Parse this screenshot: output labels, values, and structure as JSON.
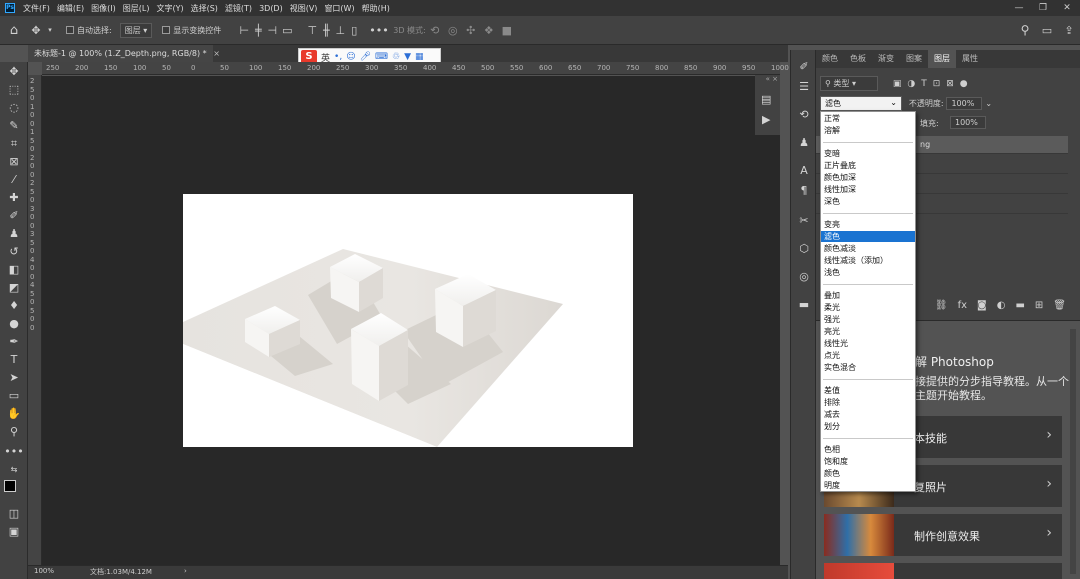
{
  "menubar": {
    "items": [
      "文件(F)",
      "编辑(E)",
      "图像(I)",
      "图层(L)",
      "文字(Y)",
      "选择(S)",
      "滤镜(T)",
      "3D(D)",
      "视图(V)",
      "窗口(W)",
      "帮助(H)"
    ]
  },
  "options": {
    "auto_select_label": "自动选择:",
    "layer_select": "图层",
    "show_transform_label": "显示变换控件",
    "mode_3d_label": "3D 模式:"
  },
  "document": {
    "tab_title": "未标题-1 @ 100% (1.Z_Depth.png, RGB/8) *",
    "close_glyph": "×"
  },
  "ruler": {
    "h_labels": [
      "250",
      "200",
      "150",
      "100",
      "50",
      "0",
      "50",
      "100",
      "150",
      "200",
      "250",
      "300",
      "350",
      "400",
      "450",
      "500",
      "550",
      "600",
      "650",
      "700",
      "750",
      "800",
      "850",
      "900",
      "950",
      "1000"
    ],
    "v_labels": [
      "2",
      "5",
      "0",
      "1",
      "0",
      "0",
      "1",
      "5",
      "0",
      "2",
      "0",
      "0",
      "2",
      "5",
      "0",
      "3",
      "0",
      "0",
      "3",
      "5",
      "0",
      "4",
      "0",
      "0",
      "4",
      "5",
      "0",
      "5",
      "0",
      "0"
    ]
  },
  "status": {
    "zoom": "100%",
    "doc_info": "文档:1.03M/4.12M"
  },
  "panel": {
    "tabs": [
      "颜色",
      "色板",
      "渐变",
      "图案",
      "图层",
      "属性"
    ],
    "active_tab": "图层",
    "filter_label": "类型",
    "blend_mode": "滤色",
    "opacity_label": "不透明度:",
    "opacity_value": "100%",
    "fill_label": "填充:",
    "fill_value": "100%",
    "layer_name_suffix": "ng"
  },
  "blend_menu": {
    "groups": [
      [
        "正常",
        "溶解"
      ],
      [
        "变暗",
        "正片叠底",
        "颜色加深",
        "线性加深",
        "深色"
      ],
      [
        "变亮",
        "滤色",
        "颜色减淡",
        "线性减淡（添加）",
        "浅色"
      ],
      [
        "叠加",
        "柔光",
        "强光",
        "亮光",
        "线性光",
        "点光",
        "实色混合"
      ],
      [
        "差值",
        "排除",
        "减去",
        "划分"
      ],
      [
        "色相",
        "饱和度",
        "颜色",
        "明度"
      ]
    ],
    "selected": "滤色"
  },
  "learn": {
    "title": "解 Photoshop",
    "desc": "接提供的分步指导教程。从一个主题开始教程。",
    "cards": [
      "本技能",
      "复照片",
      "制作创意效果"
    ]
  },
  "colors": {
    "menu_bg": "#323232",
    "canvas_bg": "#282828",
    "highlight": "#1a73d1"
  }
}
